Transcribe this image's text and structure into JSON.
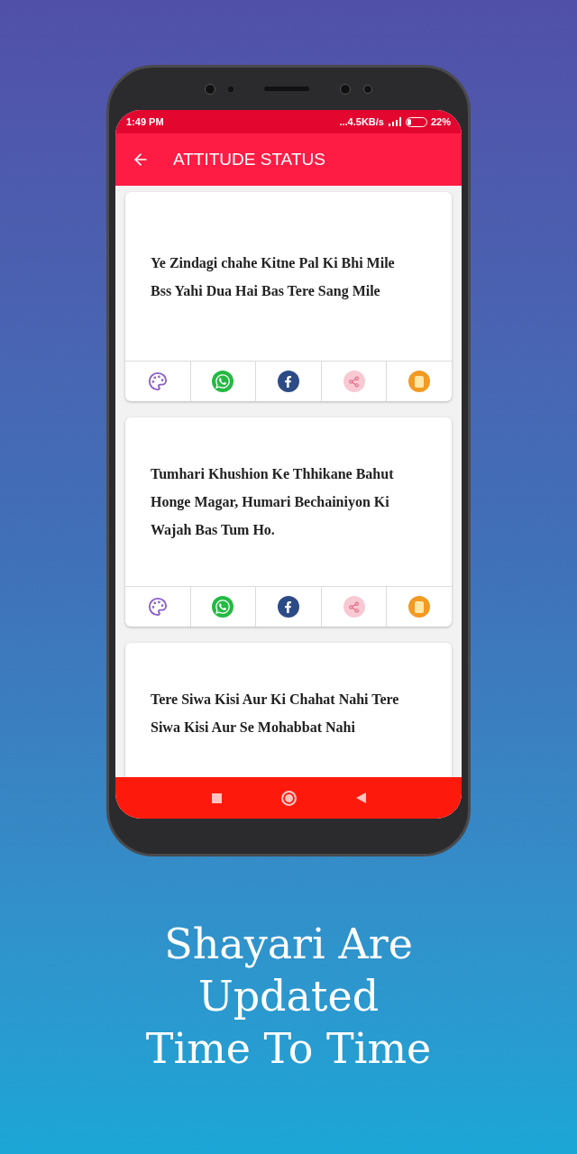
{
  "status_bar": {
    "time": "1:49 PM",
    "network_speed": "...4.5KB/s",
    "battery": "22%",
    "battery_meter": {
      "level": 0.22
    }
  },
  "app_bar": {
    "title": "ATTITUDE STATUS"
  },
  "cards": [
    {
      "kind": "full",
      "text": "Ye Zindagi chahe Kitne Pal Ki Bhi Mile Bss Yahi Dua Hai Bas Tere Sang Mile"
    },
    {
      "kind": "full",
      "text": "Tumhari Khushion Ke Thhikane Bahut Honge Magar, Humari Bechainiyon Ki Wajah Bas Tum Ho."
    },
    {
      "kind": "cut",
      "text": "Tere Siwa Kisi Aur Ki Chahat Nahi Tere Siwa Kisi Aur Se Mohabbat Nahi"
    }
  ],
  "caption": [
    "Shayari Are",
    "Updated",
    "Time To Time"
  ]
}
